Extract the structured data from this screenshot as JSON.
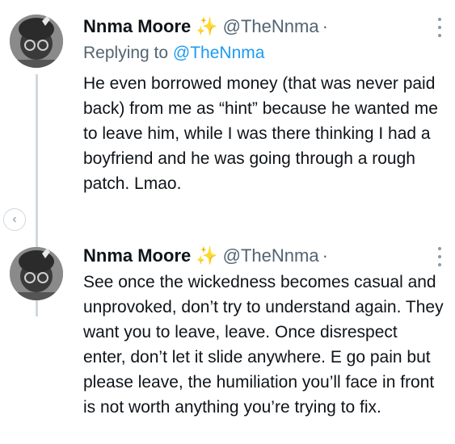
{
  "tweets": [
    {
      "name": "Nnma Moore",
      "badge_icon": "sparkles-emoji",
      "handle": "@TheNnma",
      "separator": "·",
      "replying_prefix": "Replying to",
      "replying_handle": "@TheNnma",
      "text": "He even borrowed money (that was never paid back) from me as “hint” because he wanted me to leave him, while I was there thinking I had a boyfriend and he was going through a rough patch. Lmao."
    },
    {
      "name": "Nnma Moore",
      "badge_icon": "sparkles-emoji",
      "handle": "@TheNnma",
      "separator": "·",
      "text": "See once the wickedness becomes casual and unprovoked, don’t try to understand again. They want you to leave, leave. Once disrespect enter, don’t let it slide anywhere. E go pain but please leave, the humiliation you’ll face in front is not worth anything you’re trying to fix."
    }
  ],
  "icons": {
    "more": "more-vertical-icon",
    "side_nav": "chevron-left-icon"
  },
  "colors": {
    "link": "#1d9bf0",
    "secondary_text": "#536471",
    "thread_line": "#cfd9de"
  }
}
